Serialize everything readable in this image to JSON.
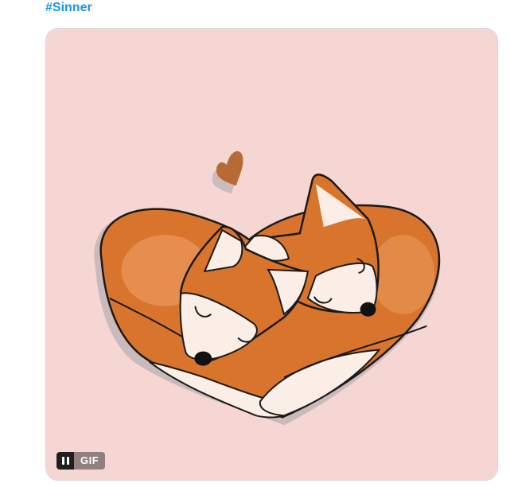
{
  "tweet": {
    "hashtag": "#Sinner"
  },
  "media": {
    "type_badge": "GIF",
    "pause_icon": "pause-icon",
    "background_color": "#f6d6d3",
    "illustration": "two-foxes-curled-in-heart-shape"
  },
  "colors": {
    "hashtag": "#1b95e0",
    "fur_orange": "#d9742c",
    "fur_light": "#fbeee6",
    "outline": "#1a1a1a"
  }
}
